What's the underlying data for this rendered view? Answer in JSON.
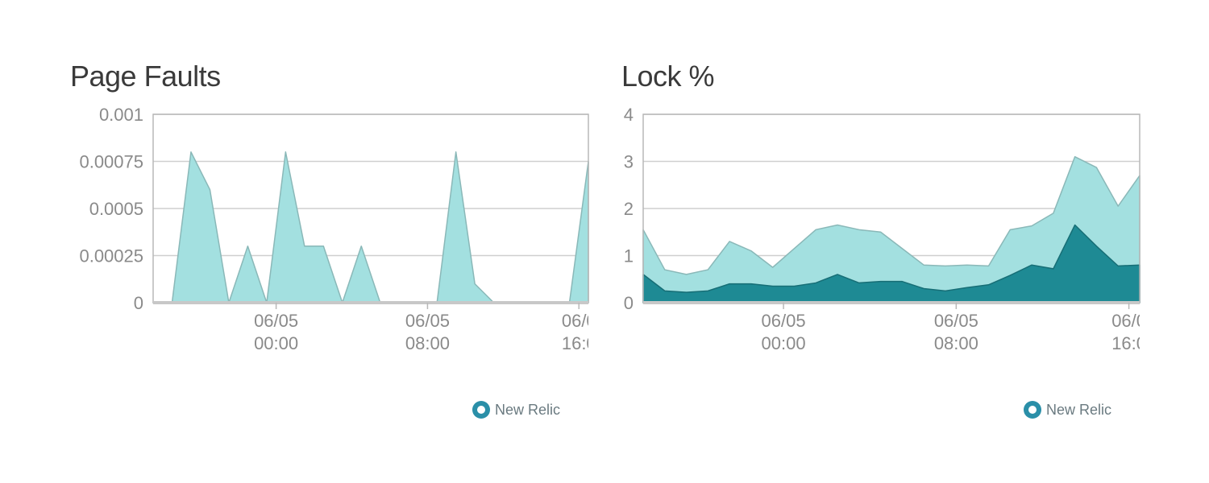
{
  "colors": {
    "light_area": "#a3e0e0",
    "light_stroke": "#8ab8b8",
    "dark_area": "#1e8a94",
    "grid": "#cfcfcf",
    "axis": "#b8b8b8",
    "tick": "#8a8a8a"
  },
  "brand": {
    "label": "New Relic",
    "icon": "new-relic-logo-icon"
  },
  "chart_data": [
    {
      "type": "area",
      "title": "Page Faults",
      "ylim": [
        0,
        0.001
      ],
      "yticks": [
        "0.001",
        "0.00075",
        "0.0005",
        "0.00025",
        "0"
      ],
      "ytick_values": [
        0.001,
        0.00075,
        0.0005,
        0.00025,
        0
      ],
      "xlim": [
        0,
        23
      ],
      "xticks": [
        {
          "x": 6.5,
          "date": "06/05",
          "time": "00:00"
        },
        {
          "x": 14.5,
          "date": "06/05",
          "time": "08:00"
        },
        {
          "x": 22.5,
          "date": "06/0",
          "time": "16:0"
        }
      ],
      "grid": true,
      "series": [
        {
          "x": [
            0,
            1,
            2,
            3,
            4,
            5,
            6,
            7,
            8,
            9,
            10,
            11,
            12,
            13,
            14,
            15,
            16,
            17,
            18,
            19,
            20,
            21,
            22,
            23
          ],
          "values": [
            0,
            0,
            0.0008,
            0.0006,
            0,
            0.0003,
            0,
            0.0008,
            0.0003,
            0.0003,
            0,
            0.0003,
            0,
            0,
            0,
            0,
            0.0008,
            0.0001,
            0,
            0,
            0,
            0,
            0,
            0.00075
          ]
        }
      ]
    },
    {
      "type": "area",
      "title": "Lock %",
      "ylim": [
        0,
        4
      ],
      "yticks": [
        "4",
        "3",
        "2",
        "1",
        "0"
      ],
      "ytick_values": [
        4,
        3,
        2,
        1,
        0
      ],
      "xlim": [
        0,
        23
      ],
      "xticks": [
        {
          "x": 6.5,
          "date": "06/05",
          "time": "00:00"
        },
        {
          "x": 14.5,
          "date": "06/05",
          "time": "08:00"
        },
        {
          "x": 22.5,
          "date": "06/0",
          "time": "16:0"
        }
      ],
      "grid": true,
      "series": [
        {
          "x": [
            0,
            1,
            2,
            3,
            4,
            5,
            6,
            7,
            8,
            9,
            10,
            11,
            12,
            13,
            14,
            15,
            16,
            17,
            18,
            19,
            20,
            21,
            22,
            23
          ],
          "values": [
            1.55,
            0.7,
            0.6,
            0.7,
            1.3,
            1.1,
            0.75,
            1.15,
            1.55,
            1.65,
            1.55,
            1.5,
            1.15,
            0.8,
            0.78,
            0.8,
            0.78,
            1.55,
            1.63,
            1.9,
            3.1,
            2.87,
            2.05,
            2.7
          ]
        },
        {
          "x": [
            0,
            1,
            2,
            3,
            4,
            5,
            6,
            7,
            8,
            9,
            10,
            11,
            12,
            13,
            14,
            15,
            16,
            17,
            18,
            19,
            20,
            21,
            22,
            23
          ],
          "values": [
            0.6,
            0.25,
            0.22,
            0.25,
            0.4,
            0.4,
            0.35,
            0.35,
            0.42,
            0.6,
            0.42,
            0.45,
            0.45,
            0.3,
            0.25,
            0.32,
            0.38,
            0.58,
            0.8,
            0.72,
            1.65,
            1.2,
            0.78,
            0.8
          ]
        }
      ]
    }
  ]
}
